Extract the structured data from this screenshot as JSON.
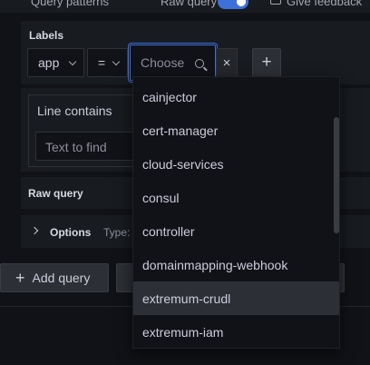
{
  "topbar": {
    "query_patterns_label": "Query patterns",
    "raw_query_label": "Raw query",
    "give_feedback_label": "Give feedback"
  },
  "labels_section": {
    "title": "Labels",
    "label_select_value": "app",
    "operator_value": "=",
    "value_placeholder": "Choose",
    "remove_symbol": "×",
    "add_symbol": "+"
  },
  "line_filter": {
    "type_label": "Line contains",
    "placeholder": "Text to find"
  },
  "raw_query": {
    "title": "Raw query"
  },
  "options": {
    "title": "Options",
    "type_prefix": "Type:"
  },
  "actions": {
    "add_query_label": "Add query",
    "add_symbol": "+"
  },
  "dropdown": {
    "options": [
      "cainjector",
      "cert-manager",
      "cloud-services",
      "consul",
      "controller",
      "domainmapping-webhook",
      "extremum-crudl",
      "extremum-iam"
    ],
    "highlighted": "extremum-crudl"
  },
  "colors": {
    "background": "#111217",
    "panel": "#181b1f",
    "accent": "#3d71d9",
    "highlight": "#2c2f36"
  },
  "icons": [
    "chevron-down-icon",
    "toggle-icon",
    "feedback-icon",
    "search-icon",
    "close-icon",
    "plus-icon",
    "chevron-right-icon"
  ]
}
